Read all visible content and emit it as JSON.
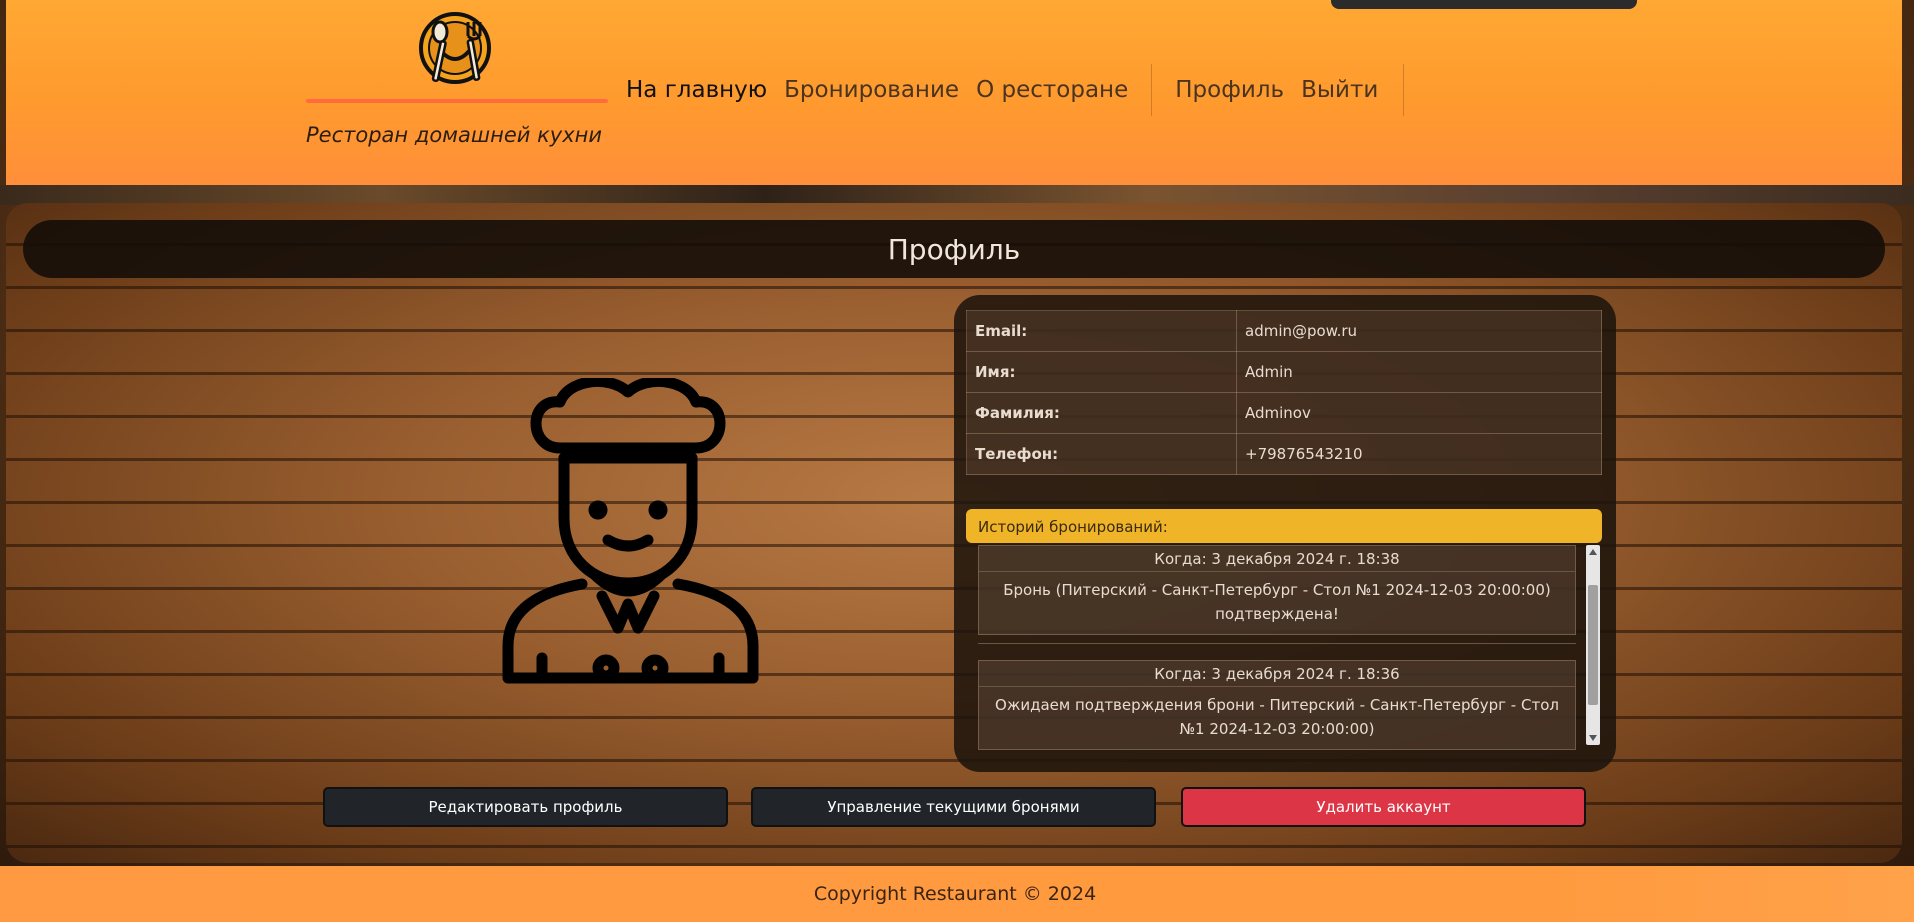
{
  "brand": {
    "tagline": "Ресторан домашней кухни",
    "icon": "smiley-plate-with-spoon-and-fork-icon"
  },
  "nav": {
    "items": [
      {
        "label": "На главную",
        "active": true
      },
      {
        "label": "Бронирование",
        "active": false
      },
      {
        "label": "О ресторане",
        "active": false
      }
    ],
    "profile": "Профиль",
    "logout": "Выйти"
  },
  "page": {
    "title": "Профиль",
    "avatar_icon": "chef-icon"
  },
  "profile": {
    "rows": [
      {
        "label": "Email:",
        "value": "admin@pow.ru"
      },
      {
        "label": "Имя:",
        "value": "Admin"
      },
      {
        "label": "Фамилия:",
        "value": "Adminov"
      },
      {
        "label": "Телефон:",
        "value": "+79876543210"
      }
    ]
  },
  "history": {
    "title": "Историй бронирований:",
    "items": [
      {
        "when": "Когда: 3 декабря 2024 г. 18:38",
        "message": "Бронь (Питерский - Санкт-Петербург - Стол №1 2024-12-03 20:00:00) подтверждена!"
      },
      {
        "when": "Когда: 3 декабря 2024 г. 18:36",
        "message": "Ожидаем подтверждения брони - Питерский - Санкт-Петербург - Стол №1 2024-12-03 20:00:00)"
      }
    ]
  },
  "actions": {
    "edit": "Редактировать профиль",
    "manage": "Управление текущими бронями",
    "delete": "Удалить аккаунт"
  },
  "footer": {
    "text": "Copyright Restaurant © 2024"
  },
  "colors": {
    "header": "#ffa833",
    "accent_line": "#ff6b3d",
    "history_header": "#f0b429",
    "danger": "#dc3545",
    "dark_button": "#212529"
  }
}
